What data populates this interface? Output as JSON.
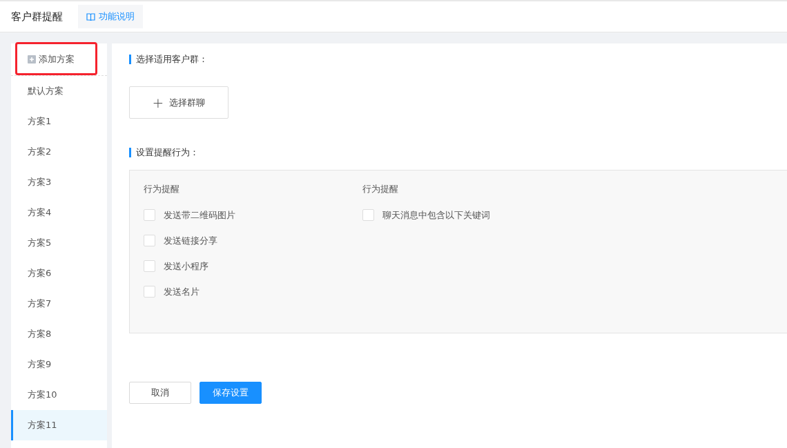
{
  "header": {
    "title": "客户群提醒",
    "help_link": "功能说明"
  },
  "sidebar": {
    "add_button": "添加方案",
    "highlighted": true,
    "items": [
      {
        "label": "默认方案",
        "selected": false
      },
      {
        "label": "方案1",
        "selected": false
      },
      {
        "label": "方案2",
        "selected": false
      },
      {
        "label": "方案3",
        "selected": false
      },
      {
        "label": "方案4",
        "selected": false
      },
      {
        "label": "方案5",
        "selected": false
      },
      {
        "label": "方案6",
        "selected": false
      },
      {
        "label": "方案7",
        "selected": false
      },
      {
        "label": "方案8",
        "selected": false
      },
      {
        "label": "方案9",
        "selected": false
      },
      {
        "label": "方案10",
        "selected": false
      },
      {
        "label": "方案11",
        "selected": true
      }
    ]
  },
  "group_section": {
    "heading": "选择适用客户群：",
    "button_icon": "+",
    "button": "选择群聊"
  },
  "behavior_section": {
    "heading": "设置提醒行为：",
    "columns": [
      {
        "title": "行为提醒",
        "options": [
          {
            "label": "发送带二维码图片",
            "checked": false
          },
          {
            "label": "发送链接分享",
            "checked": false
          },
          {
            "label": "发送小程序",
            "checked": false
          },
          {
            "label": "发送名片",
            "checked": false
          }
        ]
      },
      {
        "title": "行为提醒",
        "options": [
          {
            "label": "聊天消息中包含以下关键词",
            "checked": false
          }
        ]
      }
    ]
  },
  "actions": {
    "cancel": "取消",
    "save": "保存设置"
  }
}
